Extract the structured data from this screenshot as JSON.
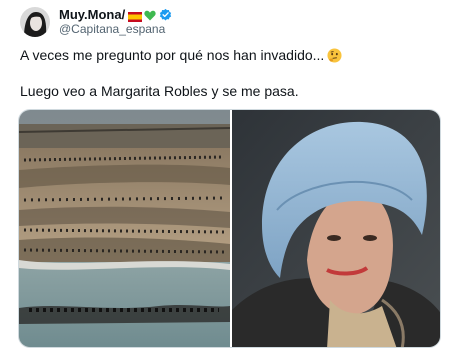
{
  "tweet": {
    "author_name": "Muy.Mona/",
    "author_handle": "@Capitana_espana",
    "line1": "A veces me pregunto por qué nos han invadido...",
    "line2": "Luego veo a Margarita Robles y se me pasa."
  },
  "icons": {
    "flag": "spain-flag-icon",
    "heart": "green-heart-icon",
    "verified": "verified-badge-icon",
    "emoji": "thinking-face-icon"
  },
  "colors": {
    "text": "#0f1419",
    "secondary": "#536471",
    "verified": "#1d9bf0",
    "heart": "#3fb950"
  }
}
